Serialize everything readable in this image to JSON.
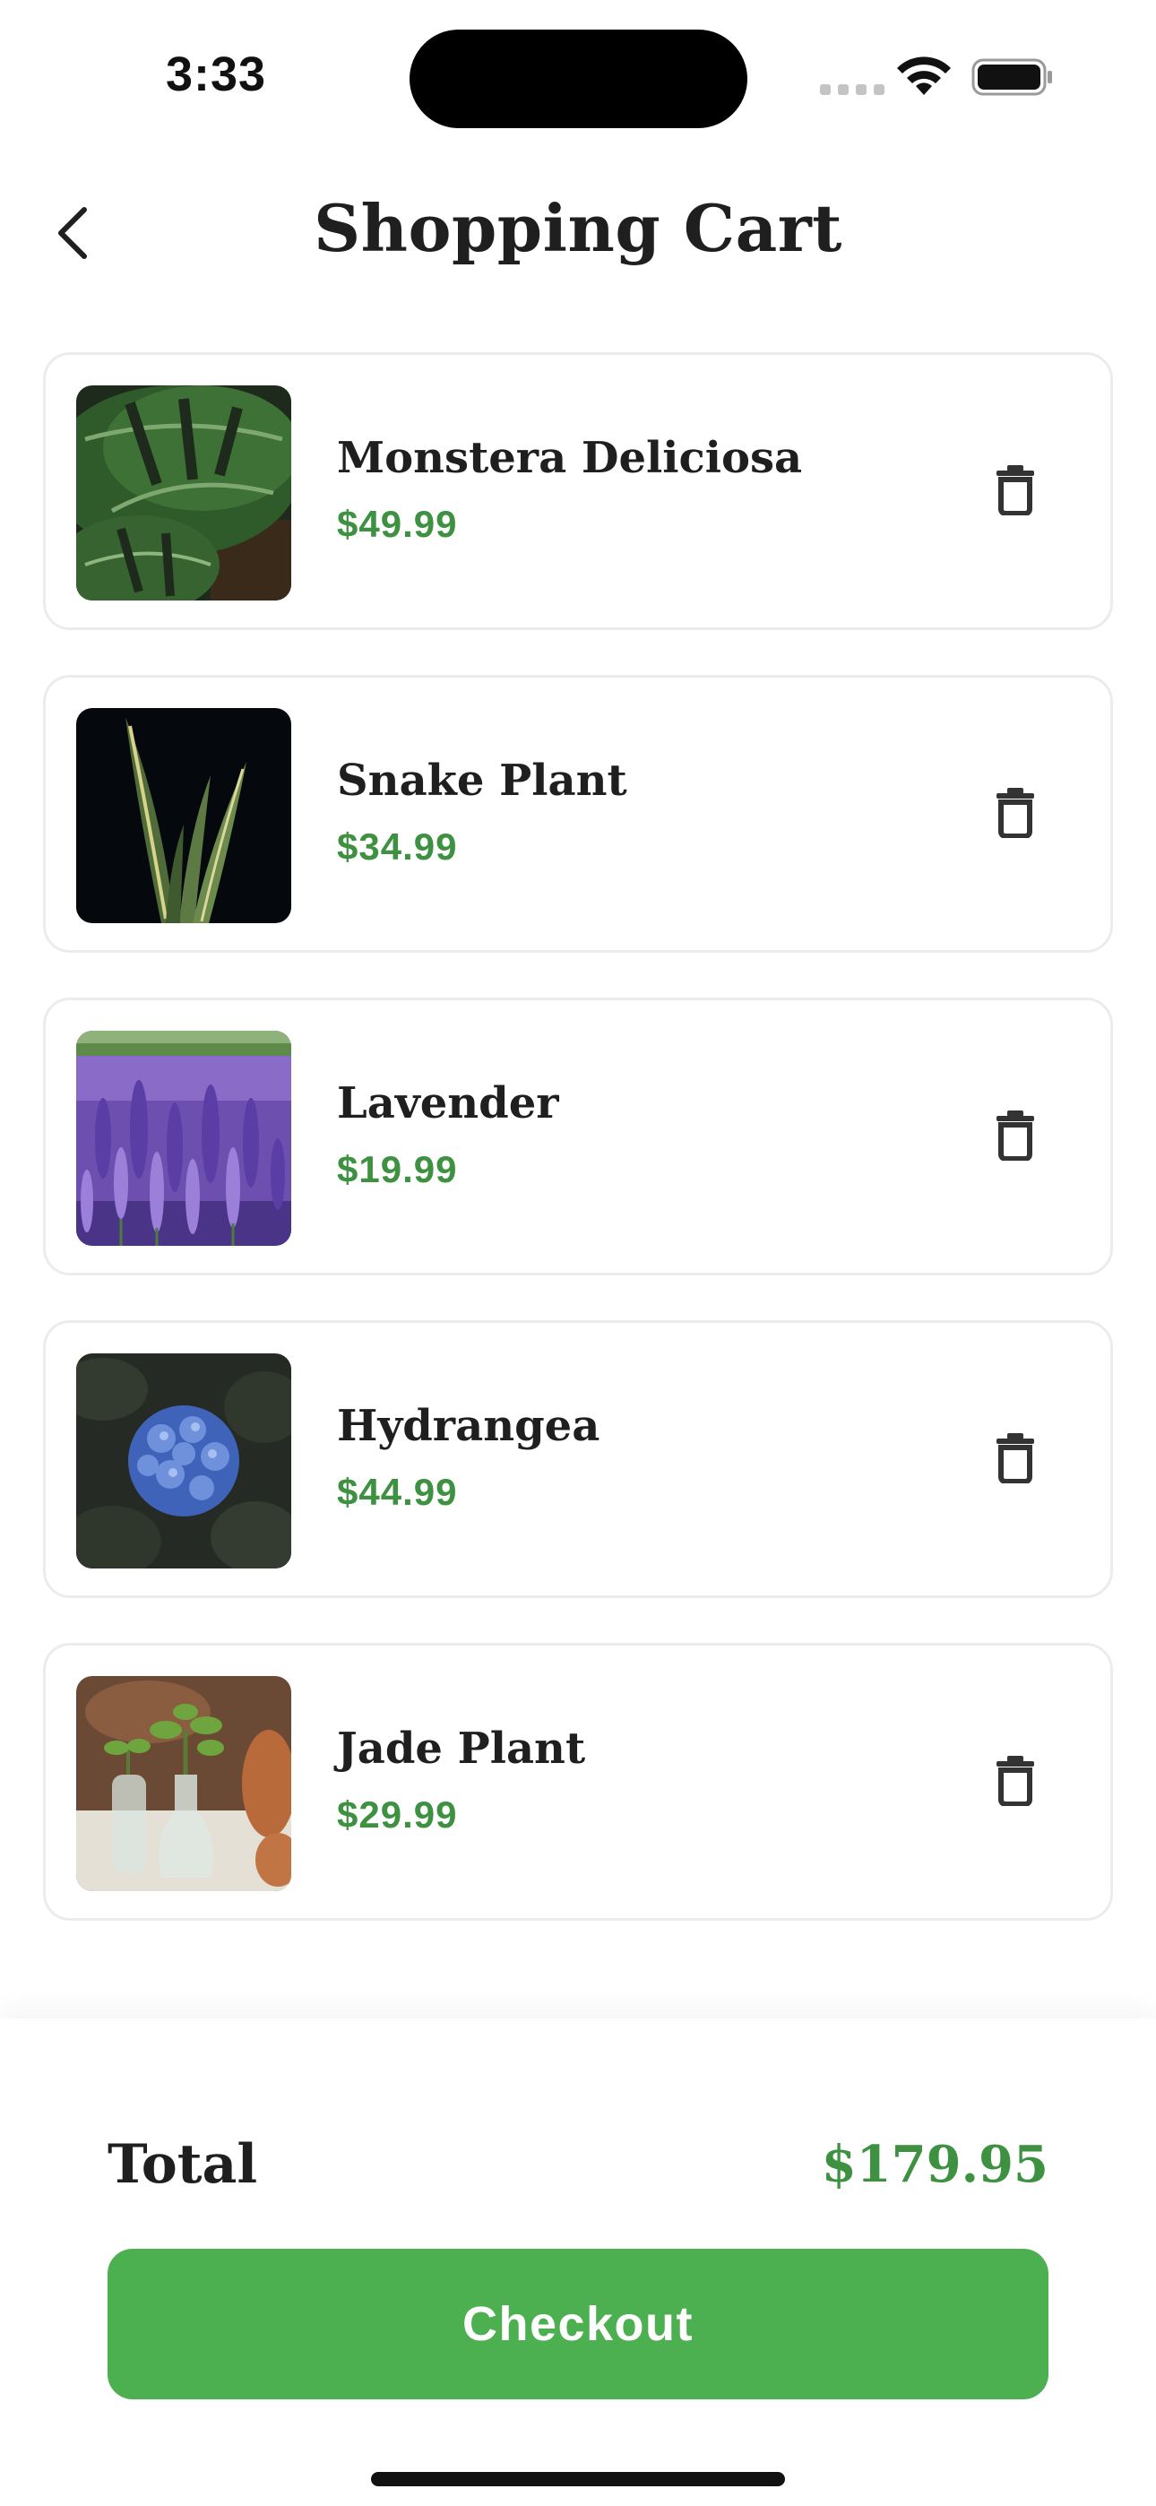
{
  "status_bar": {
    "time": "3:33"
  },
  "header": {
    "title": "Shopping Cart",
    "back_icon": "chevron-left-icon"
  },
  "cart": {
    "items": [
      {
        "name": "Monstera Deliciosa",
        "price": "$49.99",
        "thumbnail": "monstera-leaf"
      },
      {
        "name": "Snake Plant",
        "price": "$34.99",
        "thumbnail": "snake-plant"
      },
      {
        "name": "Lavender",
        "price": "$19.99",
        "thumbnail": "lavender-field"
      },
      {
        "name": "Hydrangea",
        "price": "$44.99",
        "thumbnail": "blue-hydrangea"
      },
      {
        "name": "Jade Plant",
        "price": "$29.99",
        "thumbnail": "jade-cuttings"
      }
    ],
    "delete_icon": "trash-icon"
  },
  "footer": {
    "total_label": "Total",
    "total_value": "$179.95",
    "checkout_label": "Checkout"
  },
  "colors": {
    "accent_green": "#4caf50",
    "price_green": "#3d9141",
    "title_text": "#1f1f1f",
    "card_border": "#ececec"
  }
}
